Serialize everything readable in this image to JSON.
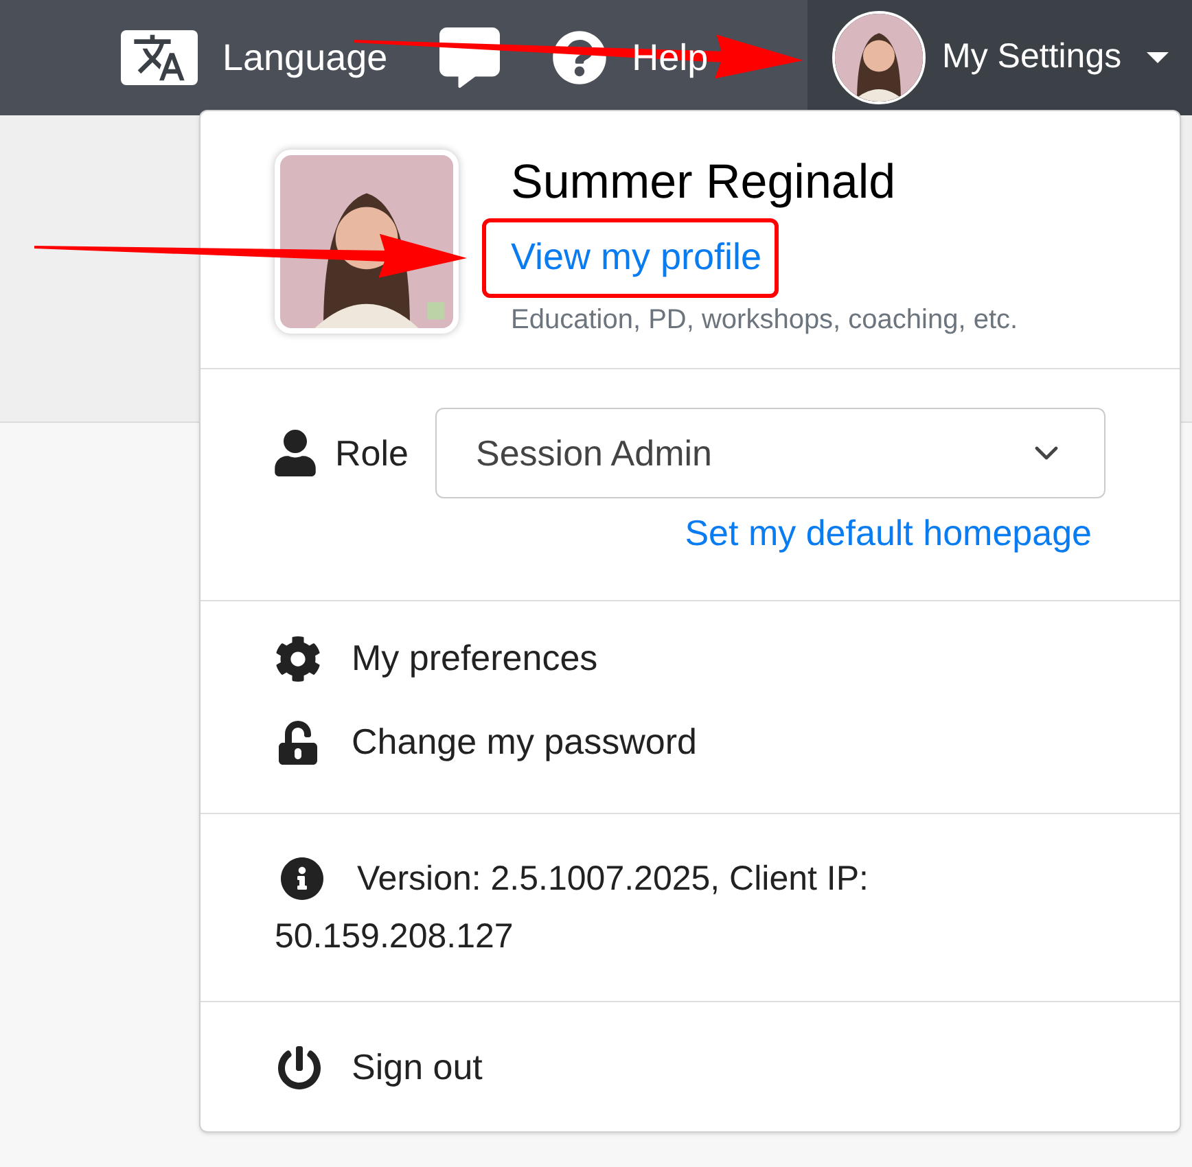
{
  "top_bar": {
    "items": [
      {
        "kind": "language",
        "label": "Language"
      },
      {
        "kind": "chat"
      },
      {
        "kind": "help",
        "label": "Help"
      }
    ],
    "settings_menu": {
      "label": "My Settings",
      "expanded": true
    }
  },
  "profile": {
    "name": "Summer Reginald",
    "link": "View my profile",
    "subtitle": "Education, PD, workshops, coaching, etc."
  },
  "role": {
    "label": "Role",
    "value": "Session Admin",
    "link": "Set my default homepage"
  },
  "menu_items": [
    {
      "kind": "gear",
      "label": "My preferences"
    },
    {
      "kind": "lock",
      "label": "Change my password"
    }
  ],
  "version_lines": [
    "Version: 2.5.1007.2025, Client IP:",
    "50.159.208.127"
  ],
  "sign_out": "Sign out"
}
